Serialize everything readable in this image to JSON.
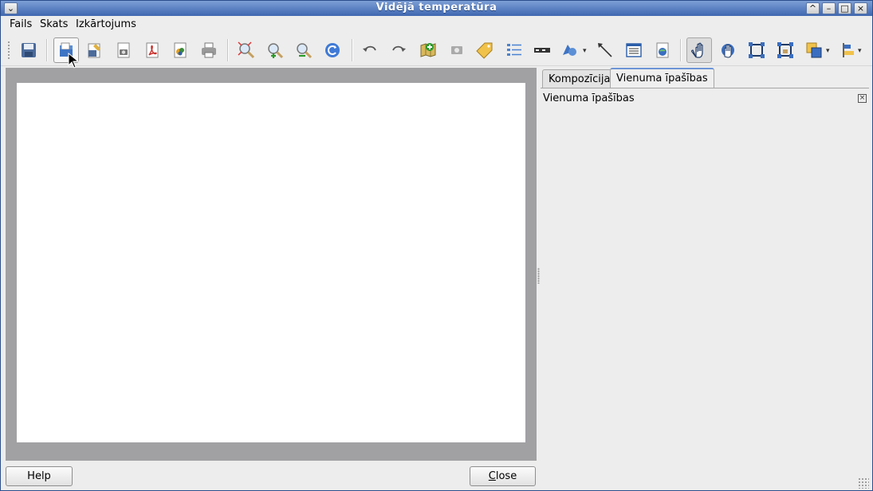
{
  "window": {
    "title": "Vidējā temperatūra"
  },
  "menubar": {
    "items": [
      "Fails",
      "Skats",
      "Izkārtojums"
    ]
  },
  "toolbar": {
    "tools": [
      "save-icon",
      "open-template-icon",
      "save-template-icon",
      "export-image-icon",
      "export-pdf-icon",
      "export-svg-icon",
      "print-icon",
      "zoom-full-icon",
      "zoom-in-icon",
      "zoom-out-icon",
      "refresh-icon",
      "undo-icon",
      "redo-icon",
      "add-map-icon",
      "add-image-icon",
      "add-label-icon",
      "add-legend-icon",
      "add-scalebar-icon",
      "add-shape-icon",
      "add-arrow-icon",
      "add-table-icon",
      "add-html-icon",
      "select-move-icon",
      "move-content-icon",
      "group-icon",
      "ungroup-icon",
      "raise-lower-icon",
      "align-icon"
    ]
  },
  "dock": {
    "tabs": [
      "Kompozīcija",
      "Vienuma īpašības"
    ],
    "active_tab": "Vienuma īpašības",
    "panel_title": "Vienuma īpašības"
  },
  "buttons": {
    "help": "Help",
    "close_first": "C",
    "close_rest": "lose"
  },
  "colors": {
    "titlebar": "#4a6fb5",
    "canvas_bg": "#a1a1a4",
    "paper": "#ffffff"
  }
}
